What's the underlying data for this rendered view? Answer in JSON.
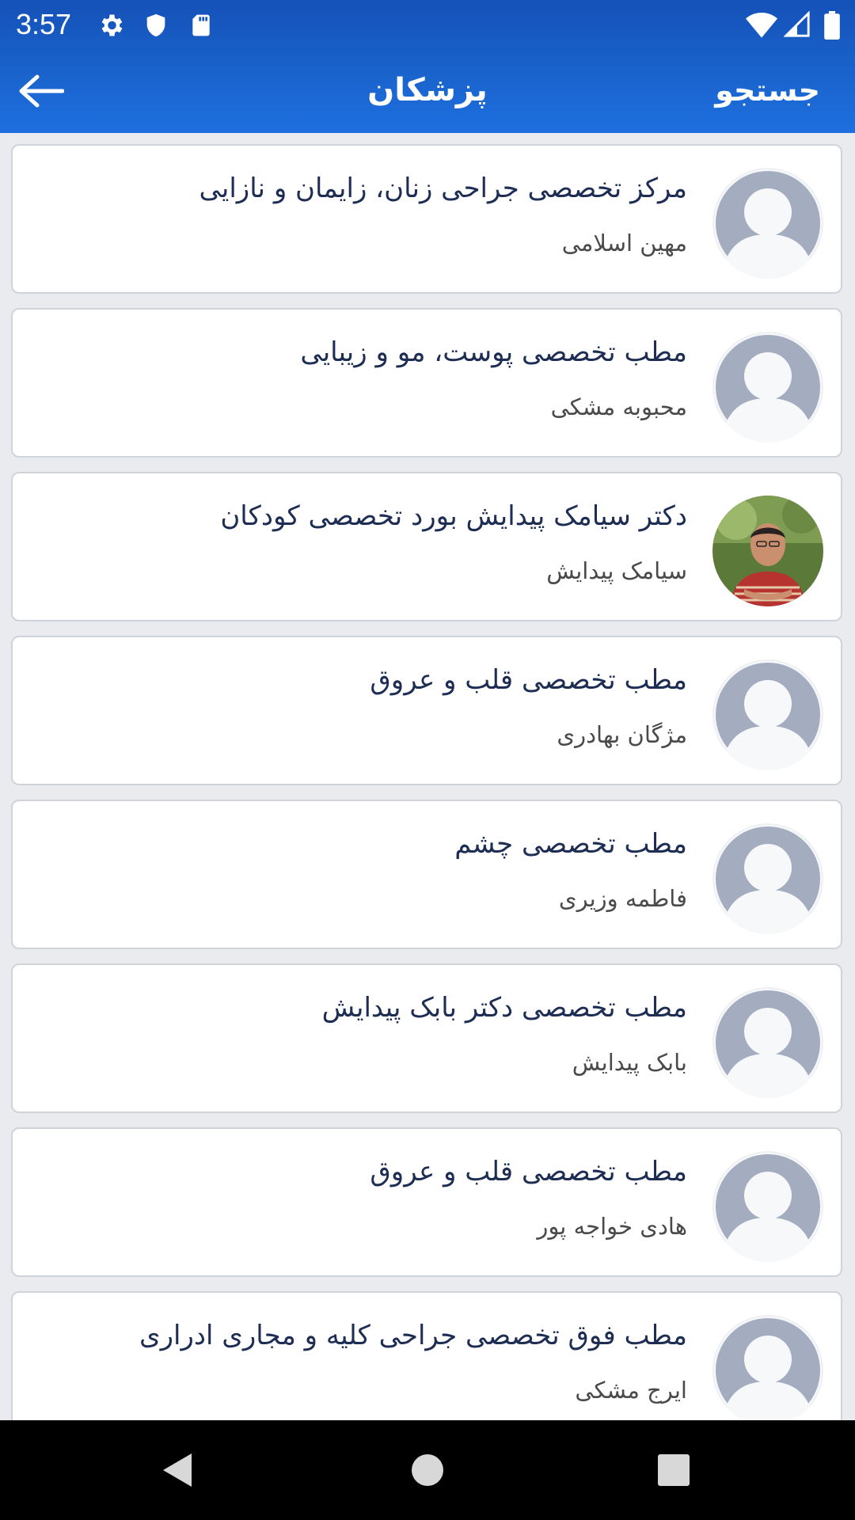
{
  "status_bar": {
    "time": "3:57",
    "left_icons": [
      "gear-icon",
      "shield-icon",
      "sd-card-icon"
    ],
    "right_icons": [
      "wifi-icon",
      "signal-icon",
      "battery-icon"
    ]
  },
  "toolbar": {
    "back_icon": "arrow-left-icon",
    "title": "پزشکان",
    "search_label": "جستجو"
  },
  "doctors": [
    {
      "clinic": "مرکز تخصصی جراحی زنان، زایمان و نازایی",
      "doctor": "مهین اسلامی",
      "avatar": "default-avatar"
    },
    {
      "clinic": "مطب تخصصی پوست، مو و زیبایی",
      "doctor": "محبوبه مشکی",
      "avatar": "default-avatar"
    },
    {
      "clinic": "دکتر سیامک پیدایش بورد تخصصی کودکان",
      "doctor": "سیامک پیدایش",
      "avatar": "photo"
    },
    {
      "clinic": "مطب تخصصی قلب و عروق",
      "doctor": "مژگان بهادری",
      "avatar": "default-avatar"
    },
    {
      "clinic": "مطب تخصصی چشم",
      "doctor": "فاطمه وزیری",
      "avatar": "default-avatar"
    },
    {
      "clinic": "مطب تخصصی دکتر بابک پیدایش",
      "doctor": "بابک پیدایش",
      "avatar": "default-avatar"
    },
    {
      "clinic": "مطب تخصصی قلب و عروق",
      "doctor": "هادی خواجه پور",
      "avatar": "default-avatar"
    },
    {
      "clinic": "مطب فوق تخصصی جراحی کلیه و مجاری ادراری",
      "doctor": "ایرج مشکی",
      "avatar": "default-avatar"
    }
  ],
  "nav_bar": {
    "icons": [
      "back-triangle-icon",
      "home-circle-icon",
      "recents-square-icon"
    ]
  },
  "colors": {
    "app_bar": "#1a63cc",
    "clinic_text": "#1d2d54",
    "doctor_text": "#4a4a4a",
    "avatar_gray": "#a3adbf"
  }
}
